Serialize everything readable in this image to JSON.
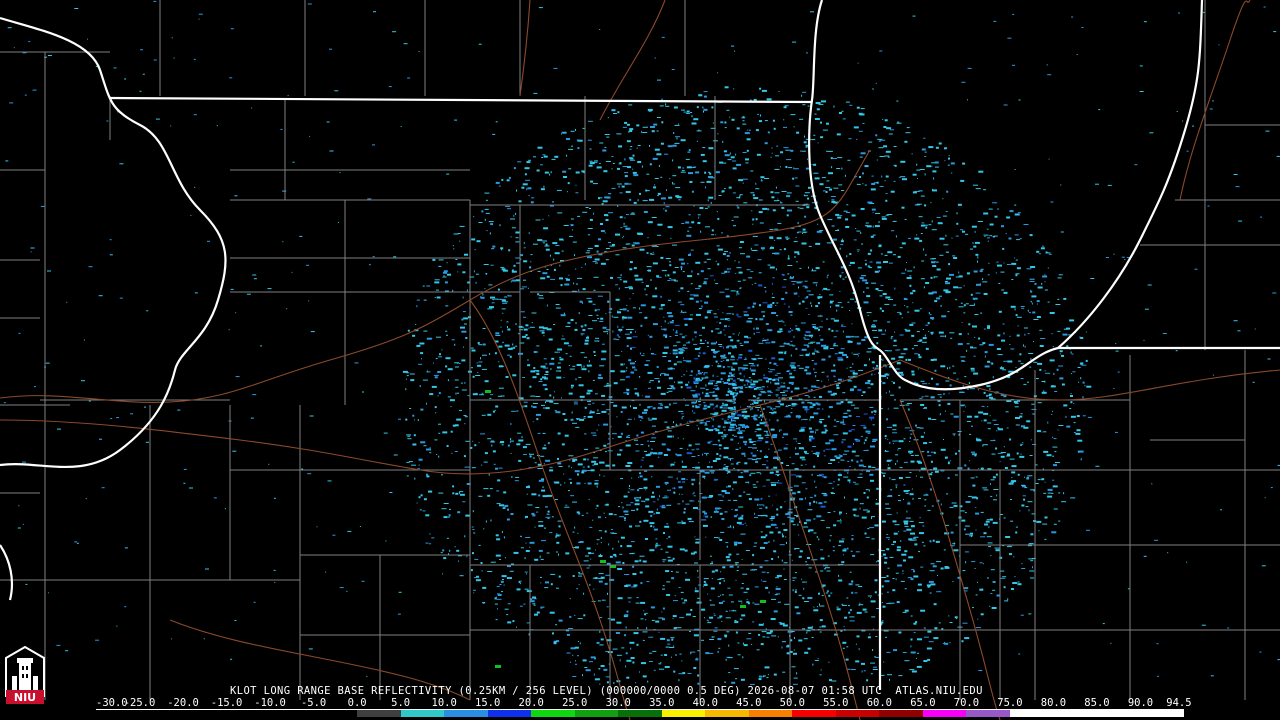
{
  "product": {
    "title": "KLOT LONG RANGE BASE REFLECTIVITY (0.25KM / 256 LEVEL) (000000/0000 0.5 DEG) 2026-08-07 01:58 UTC  ATLAS.NIU.EDU"
  },
  "logo": {
    "icon": "niu-tower-logo-icon",
    "text": "NIU",
    "color": "#c8102e"
  },
  "scale": {
    "ticks": [
      "-30.0",
      "-25.0",
      "-20.0",
      "-15.0",
      "-10.0",
      "-5.0",
      "0.0",
      "5.0",
      "10.0",
      "15.0",
      "20.0",
      "25.0",
      "30.0",
      "35.0",
      "40.0",
      "45.0",
      "50.0",
      "55.0",
      "60.0",
      "65.0",
      "70.0",
      "75.0",
      "80.0",
      "85.0",
      "90.0",
      "94.5"
    ],
    "colors": [
      "#000000",
      "#000000",
      "#000000",
      "#000000",
      "#000000",
      "#000000",
      "#3f3f3f",
      "#30c8c8",
      "#2a8fe0",
      "#1030f0",
      "#10d810",
      "#10a010",
      "#087008",
      "#f8f000",
      "#f8b800",
      "#f88000",
      "#f80000",
      "#c80000",
      "#900000",
      "#f800f8",
      "#9858c8",
      "#ffffff",
      "#ffffff",
      "#ffffff",
      "#ffffff"
    ]
  },
  "map_colors": {
    "state_border": "#ffffff",
    "county_line": "#808080",
    "highway": "#8b4a2b",
    "echo_light": "#33c8e8",
    "echo_mid": "#2a9ae0",
    "echo_dark": "#1a5ad8",
    "echo_green": "#10c020"
  }
}
